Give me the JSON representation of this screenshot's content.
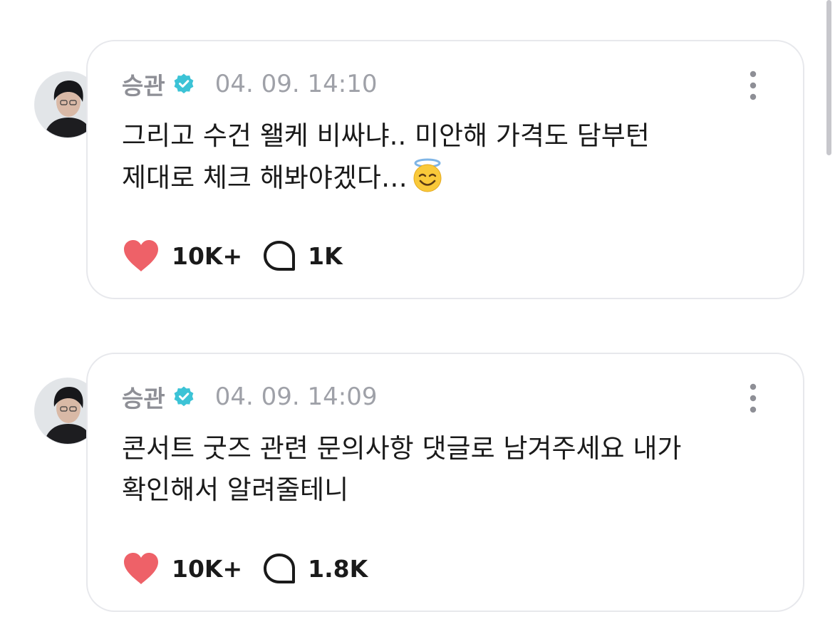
{
  "posts": [
    {
      "author": "승관",
      "timestamp": "04. 09. 14:10",
      "content_lines": [
        "그리고 수건 왤케 비싸냐.. 미안해 가격도 담부턴",
        "제대로 체크 해봐야겠다…"
      ],
      "content_emoji": "smiling-face-with-halo",
      "likes": "10K+",
      "comments": "1K"
    },
    {
      "author": "승관",
      "timestamp": "04. 09. 14:09",
      "content_lines": [
        "콘서트 굿즈 관련 문의사항 댓글로 남겨주세요 내가",
        "확인해서 알려줄테니"
      ],
      "likes": "10K+",
      "comments": "1.8K"
    }
  ],
  "icons": {
    "verified": "verified-badge-icon",
    "more": "more-vertical-icon",
    "like": "heart-icon",
    "comment": "comment-bubble-icon"
  },
  "colors": {
    "verified_badge": "#3cc3d6",
    "heart": "#ee6168",
    "name_text": "#8e8f96",
    "timestamp_text": "#9fa1a8",
    "body_text": "#1a1a1a",
    "card_border": "#e7e8ec"
  }
}
